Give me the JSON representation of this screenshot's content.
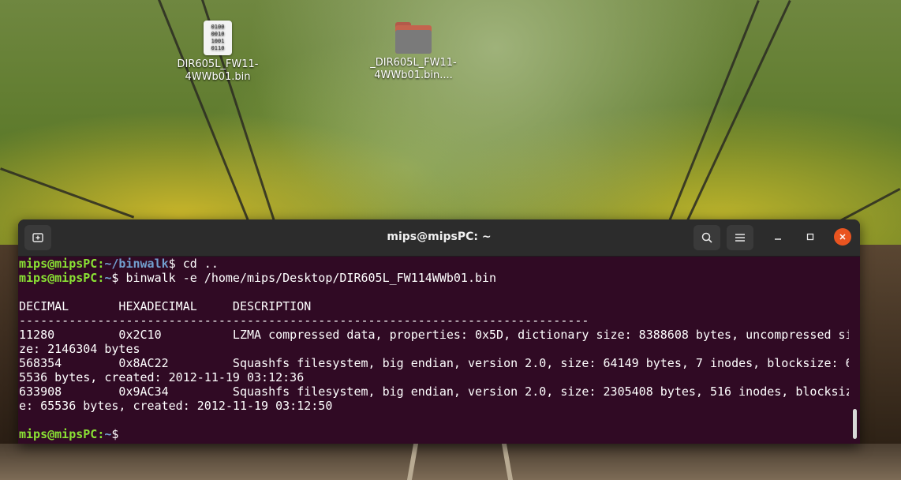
{
  "desktop": {
    "icons": [
      {
        "label": "DIR605L_FW11-\n4WWb01.bin",
        "icon": "binary-file-icon",
        "glyph": "0100\n0010\n1001\n0110"
      },
      {
        "label": "_DIR605L_FW11-\n4WWb01.bin....",
        "icon": "folder-icon"
      }
    ]
  },
  "terminal": {
    "title": "mips@mipsPC: ~",
    "new_tab_icon": "new-tab-icon",
    "search_icon": "search-icon",
    "menu_icon": "hamburger-menu-icon",
    "minimize_icon": "minimize-icon",
    "maximize_icon": "maximize-icon",
    "close_icon": "close-icon",
    "prompt_user": "mips@mipsPC",
    "prompt_sep": ":",
    "lines": [
      {
        "kind": "prompt",
        "path": "~/binwalk",
        "cmd": " cd .."
      },
      {
        "kind": "prompt",
        "path": "~",
        "cmd": " binwalk -e /home/mips/Desktop/DIR605L_FW114WWb01.bin"
      },
      {
        "kind": "text",
        "text": ""
      },
      {
        "kind": "text",
        "text": "DECIMAL       HEXADECIMAL     DESCRIPTION"
      },
      {
        "kind": "text",
        "text": "--------------------------------------------------------------------------------"
      },
      {
        "kind": "text",
        "text": "11280         0x2C10          LZMA compressed data, properties: 0x5D, dictionary size: 8388608 bytes, uncompressed si"
      },
      {
        "kind": "text",
        "text": "ze: 2146304 bytes"
      },
      {
        "kind": "text",
        "text": "568354        0x8AC22         Squashfs filesystem, big endian, version 2.0, size: 64149 bytes, 7 inodes, blocksize: 6"
      },
      {
        "kind": "text",
        "text": "5536 bytes, created: 2012-11-19 03:12:36"
      },
      {
        "kind": "text",
        "text": "633908        0x9AC34         Squashfs filesystem, big endian, version 2.0, size: 2305408 bytes, 516 inodes, blocksiz"
      },
      {
        "kind": "text",
        "text": "e: 65536 bytes, created: 2012-11-19 03:12:50"
      },
      {
        "kind": "text",
        "text": ""
      },
      {
        "kind": "prompt",
        "path": "~",
        "cmd": " "
      }
    ]
  }
}
